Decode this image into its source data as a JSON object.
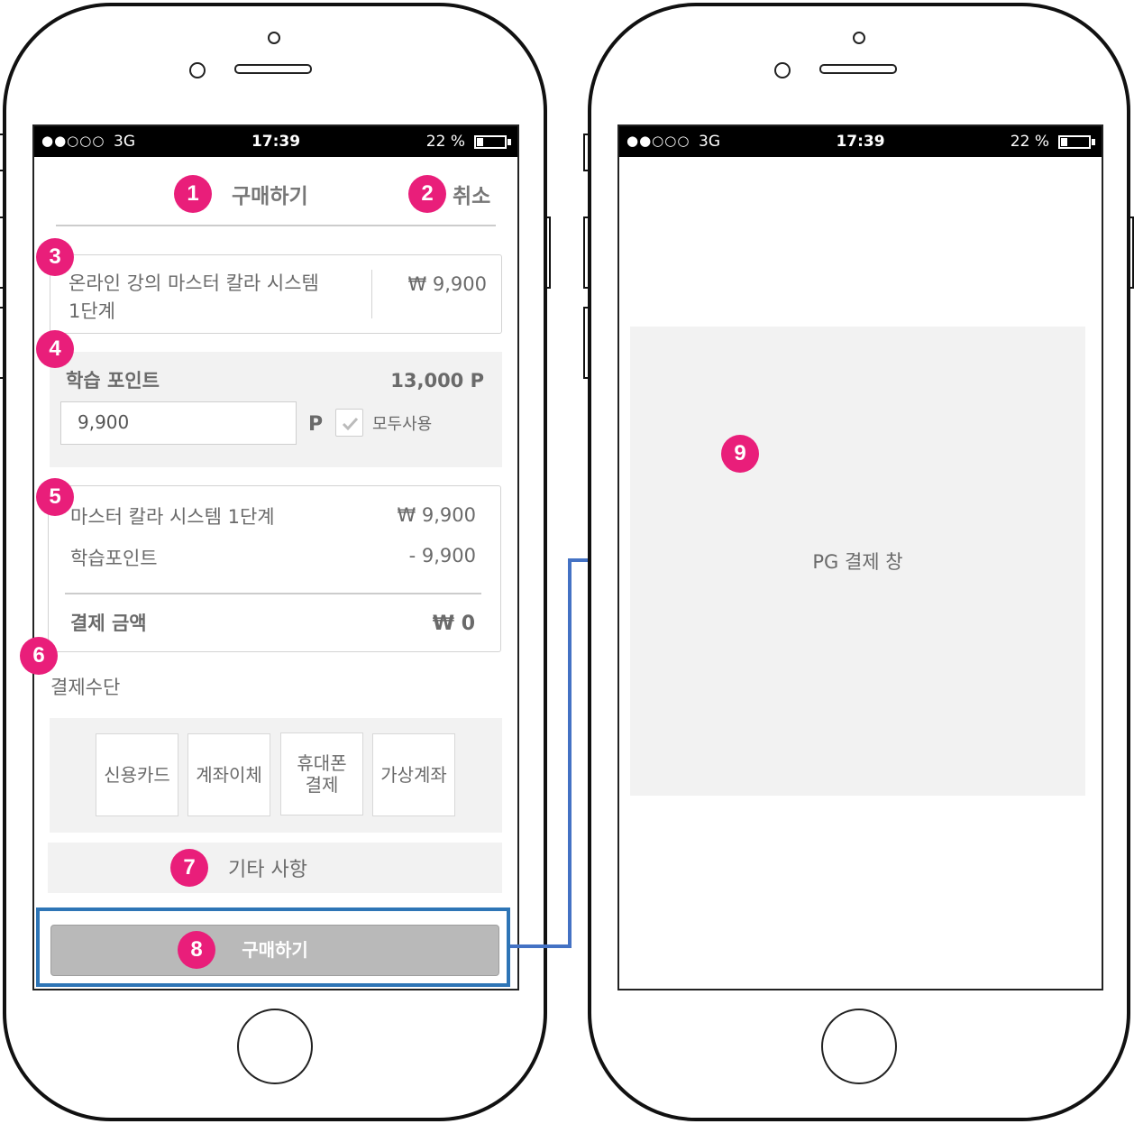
{
  "status_bar": {
    "signal": "●●○○○",
    "network": "3G",
    "time": "17:39",
    "battery_text": "22 %",
    "battery_level": 0.22
  },
  "header": {
    "title": "구매하기",
    "cancel": "취소"
  },
  "badges": [
    "1",
    "2",
    "3",
    "4",
    "5",
    "6",
    "7",
    "8",
    "9"
  ],
  "product": {
    "name_line1": "온라인 강의 마스터 칼라 시스템",
    "name_line2": "1단계",
    "price": "₩ 9,900"
  },
  "points": {
    "label": "학습 포인트",
    "balance": "13,000 P",
    "input_value": "9,900",
    "unit": "P",
    "use_all_label": "모두사용",
    "use_all_checked": true
  },
  "summary": {
    "item_label": "마스터 칼라 시스템 1단계",
    "item_price": "₩ 9,900",
    "points_label": "학습포인트",
    "points_value": "- 9,900",
    "total_label": "결제 금액",
    "total_value": "₩ 0"
  },
  "payment": {
    "label": "결제수단",
    "methods": [
      {
        "line1": "신용카드",
        "line2": ""
      },
      {
        "line1": "계좌이체",
        "line2": ""
      },
      {
        "line1": "휴대폰",
        "line2": "결제"
      },
      {
        "line1": "가상계좌",
        "line2": ""
      }
    ]
  },
  "etc_label": "기타 사항",
  "buy_button": "구매하기",
  "pg_window_label": "PG 결제 창",
  "colors": {
    "badge": "#e91e7a",
    "highlight": "#2e75b6",
    "panel_grey": "#f2f2f2"
  },
  "icons": {
    "checkbox": "check-icon",
    "flow": "flow-arrow-icon"
  }
}
